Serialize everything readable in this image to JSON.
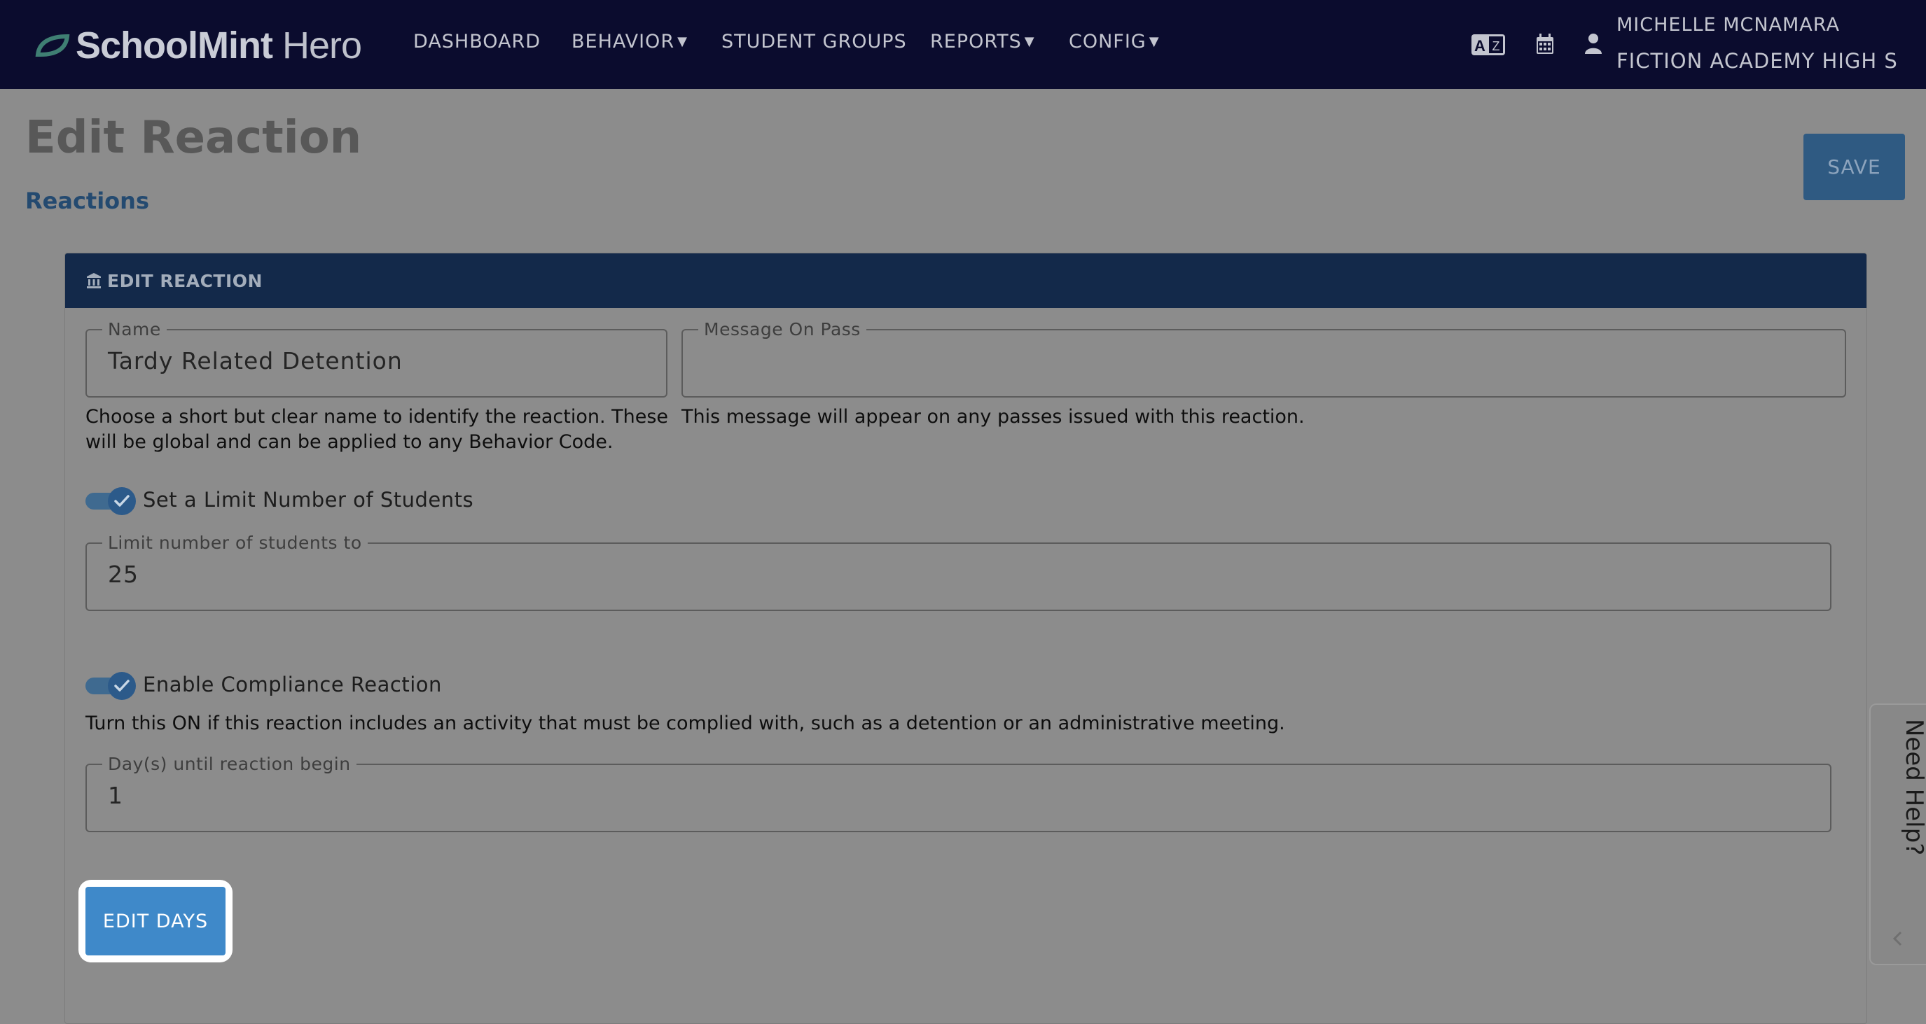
{
  "app": {
    "logo_main": "SchoolMint",
    "logo_sub": "Hero"
  },
  "nav": {
    "items": [
      {
        "label": "DASHBOARD",
        "has_caret": false
      },
      {
        "label": "BEHAVIOR",
        "has_caret": true
      },
      {
        "label": "STUDENT GROUPS",
        "has_caret": false
      },
      {
        "label": "REPORTS",
        "has_caret": true
      },
      {
        "label": "CONFIG",
        "has_caret": true
      }
    ],
    "icons": [
      "translate-icon",
      "calendar-icon",
      "user-icon"
    ],
    "user_name": "MICHELLE MCNAMARA",
    "school_name": "FICTION ACADEMY HIGH S..."
  },
  "page": {
    "title": "Edit Reaction",
    "breadcrumb": "Reactions",
    "save_label": "SAVE"
  },
  "card": {
    "header": "EDIT REACTION",
    "name_field": {
      "label": "Name",
      "value": "Tardy Related Detention",
      "help": "Choose a short but clear name to identify the reaction. These will be global and can be applied to any Behavior Code."
    },
    "message_field": {
      "label": "Message On Pass",
      "value": "",
      "help": "This message will appear on any passes issued with this reaction."
    },
    "limit_toggle": {
      "label": "Set a Limit Number of Students",
      "checked": true
    },
    "limit_field": {
      "label": "Limit number of students to",
      "value": "25"
    },
    "compliance_toggle": {
      "label": "Enable Compliance Reaction",
      "checked": true,
      "help": "Turn this ON if this reaction includes an activity that must be complied with, such as a detention or an administrative meeting."
    },
    "days_field": {
      "label": "Day(s) until reaction begin",
      "value": "1"
    },
    "edit_days_label": "EDIT DAYS"
  },
  "help_tab": {
    "label": "Need Help?"
  },
  "colors": {
    "nav_bg": "#0b0c2e",
    "card_header_bg": "#13294a",
    "primary_button": "#3f89c9",
    "overlay_bg": "#8c8c8c"
  }
}
